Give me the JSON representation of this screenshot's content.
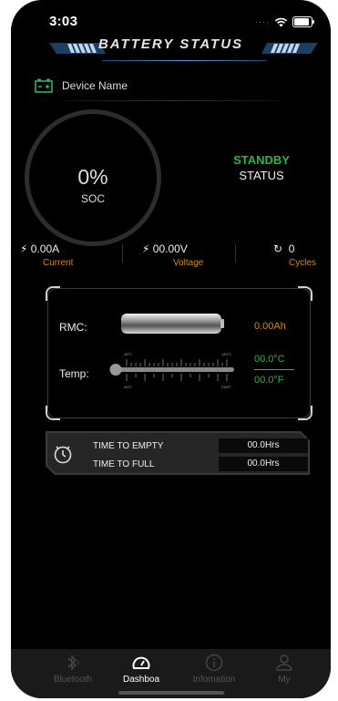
{
  "status_bar": {
    "time": "3:03"
  },
  "header": {
    "title": "BATTERY STATUS"
  },
  "device": {
    "name": "Device Name"
  },
  "soc": {
    "value": "0%",
    "label": "SOC"
  },
  "state": {
    "mode": "STANDBY",
    "label": "STATUS"
  },
  "metrics": {
    "current": {
      "value": "0.00A",
      "label": "Current"
    },
    "voltage": {
      "value": "00.00V",
      "label": "Voltage"
    },
    "cycles": {
      "value": "0",
      "label": "Cycles"
    }
  },
  "panel": {
    "rmc_label": "RMC:",
    "rmc_value": "0.00Ah",
    "temp_label": "Temp:",
    "temp_c": "00.0°C",
    "temp_f": "00.0°F",
    "scale": {
      "c_min": "-40°C",
      "c_max": "120°C",
      "f_min": "-40°F",
      "f_max": "248°F"
    }
  },
  "time": {
    "to_empty_label": "TIME TO EMPTY",
    "to_empty_value": "00.0Hrs",
    "to_full_label": "TIME TO FULL",
    "to_full_value": "00.0Hrs"
  },
  "tabs": [
    {
      "label": "Bluetooth",
      "icon": "bluetooth-icon",
      "active": false
    },
    {
      "label": "Dashboa",
      "icon": "dashboard-gauge-icon",
      "active": true
    },
    {
      "label": "Infomation",
      "icon": "info-icon",
      "active": false
    },
    {
      "label": "My",
      "icon": "user-icon",
      "active": false
    }
  ],
  "colors": {
    "accent_green": "#2fb34a",
    "accent_orange": "#d88a12",
    "background": "#000000"
  }
}
